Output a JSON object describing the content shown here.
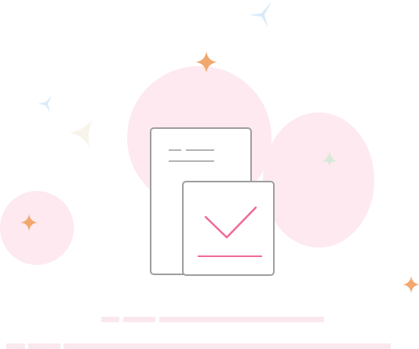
{
  "illustration": {
    "icon": "document-check-icon",
    "colors": {
      "circle": "#fde9ef",
      "check": "#f06a95",
      "document_border": "#9e9e9e",
      "text_line": "#b3b3b3",
      "spark_orange": "#f2a76e",
      "spark_blue": "#d9ebfa",
      "spark_green": "#d7ead8",
      "spark_cream": "#f8f4ea",
      "skeleton_bar": "#fbe8ee"
    }
  }
}
